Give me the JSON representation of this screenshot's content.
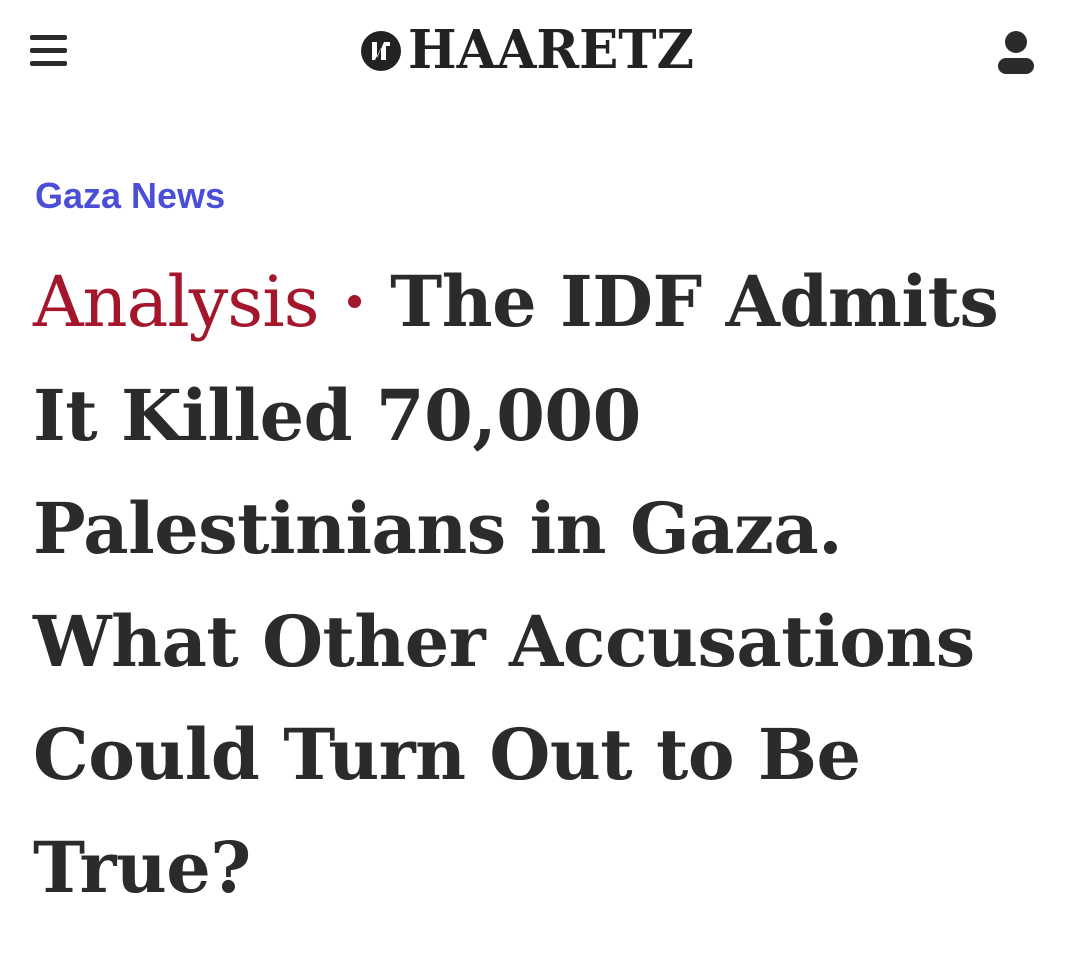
{
  "header": {
    "logo_text": "HAARETZ",
    "menu_icon": "hamburger-menu-icon",
    "user_icon": "user-account-icon"
  },
  "article": {
    "section": "Gaza News",
    "kicker": "Analysis",
    "separator": "·",
    "headline": "The IDF Admits It Killed 70,000 Palestinians in Gaza. What Other Accusations Could Turn Out to Be True?"
  },
  "colors": {
    "section_link": "#4b4fd6",
    "kicker": "#a3162b",
    "text": "#2b2b2b",
    "background": "#ffffff"
  }
}
